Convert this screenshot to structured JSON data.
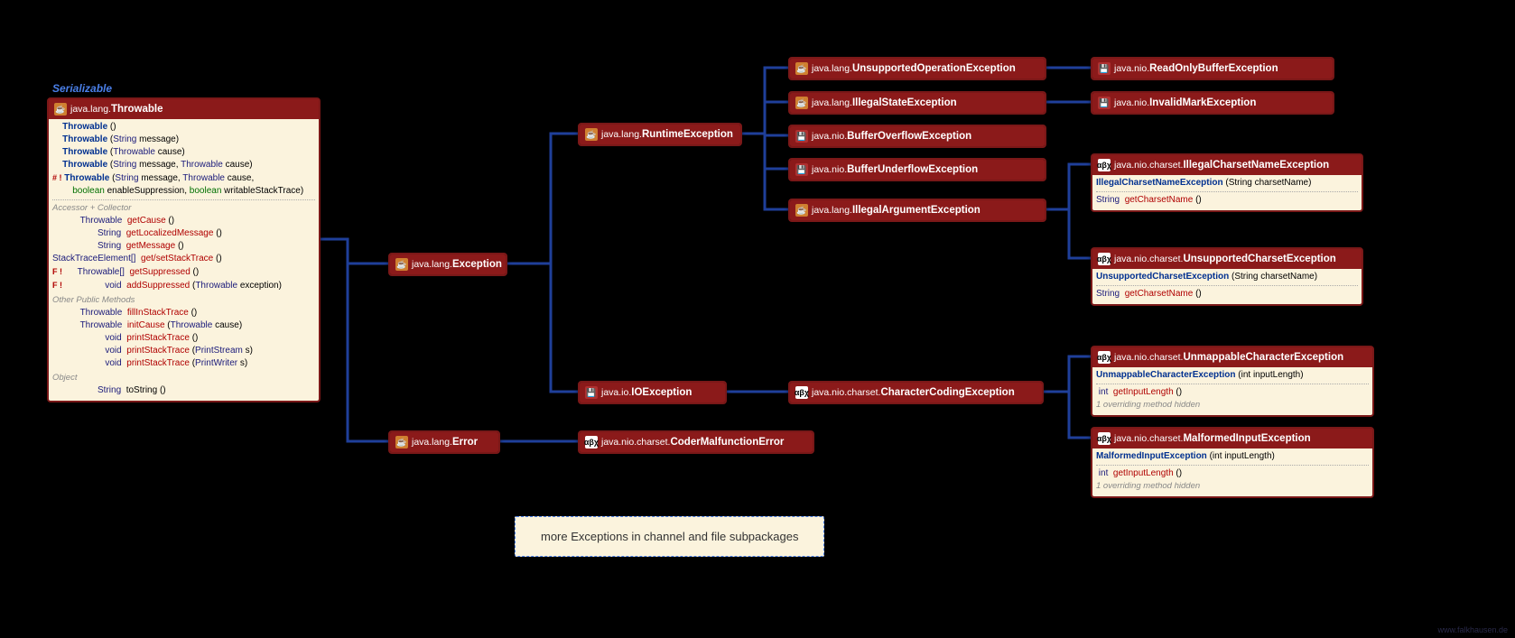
{
  "serializable_label": "Serializable",
  "throwable": {
    "pkg": "java.lang.",
    "name": "Throwable",
    "ctors": [
      {
        "name": "Throwable",
        "params": []
      },
      {
        "name": "Throwable",
        "params": [
          {
            "t": "String",
            "n": "message"
          }
        ]
      },
      {
        "name": "Throwable",
        "params": [
          {
            "t": "Throwable",
            "n": "cause"
          }
        ]
      },
      {
        "name": "Throwable",
        "params": [
          {
            "t": "String",
            "n": "message"
          },
          {
            "t": "Throwable",
            "n": "cause"
          }
        ]
      },
      {
        "name": "Throwable",
        "params": [
          {
            "t": "String",
            "n": "message"
          },
          {
            "t": "Throwable",
            "n": "cause"
          }
        ],
        "more": "boolean enableSuppression, boolean writableStackTrace",
        "marker": "# !"
      }
    ],
    "sec1": "Accessor + Collector",
    "accessors": [
      {
        "ret": "Throwable",
        "name": "getCause",
        "params": "()"
      },
      {
        "ret": "String",
        "name": "getLocalizedMessage",
        "params": "()"
      },
      {
        "ret": "String",
        "name": "getMessage",
        "params": "()"
      },
      {
        "ret": "StackTraceElement[]",
        "name": "get/setStackTrace",
        "params": "()"
      },
      {
        "ret": "Throwable[]",
        "name": "getSuppressed",
        "params": "()",
        "marker": "F !"
      },
      {
        "ret": "void",
        "name": "addSuppressed",
        "params": "(Throwable exception)",
        "marker": "F !"
      }
    ],
    "sec2": "Other Public Methods",
    "others": [
      {
        "ret": "Throwable",
        "name": "fillInStackTrace",
        "params": "()"
      },
      {
        "ret": "Throwable",
        "name": "initCause",
        "params": "(Throwable cause)"
      },
      {
        "ret": "void",
        "name": "printStackTrace",
        "params": "()"
      },
      {
        "ret": "void",
        "name": "printStackTrace",
        "params": "(PrintStream s)"
      },
      {
        "ret": "void",
        "name": "printStackTrace",
        "params": "(PrintWriter s)"
      }
    ],
    "sec3": "Object",
    "obj": [
      {
        "ret": "String",
        "name": "toString",
        "params": "()"
      }
    ]
  },
  "exception": {
    "pkg": "java.lang.",
    "name": "Exception"
  },
  "error": {
    "pkg": "java.lang.",
    "name": "Error"
  },
  "runtime": {
    "pkg": "java.lang.",
    "name": "RuntimeException"
  },
  "ioexception": {
    "pkg": "java.io.",
    "name": "IOException"
  },
  "codermalfunction": {
    "pkg": "java.nio.charset.",
    "name": "CoderMalfunctionError"
  },
  "unsupportedop": {
    "pkg": "java.lang.",
    "name": "UnsupportedOperationException"
  },
  "illegalstate": {
    "pkg": "java.lang.",
    "name": "IllegalStateException"
  },
  "bufferoverflow": {
    "pkg": "java.nio.",
    "name": "BufferOverflowException"
  },
  "bufferunderflow": {
    "pkg": "java.nio.",
    "name": "BufferUnderflowException"
  },
  "illegalarg": {
    "pkg": "java.lang.",
    "name": "IllegalArgumentException"
  },
  "readonlybuffer": {
    "pkg": "java.nio.",
    "name": "ReadOnlyBufferException"
  },
  "invalidmark": {
    "pkg": "java.nio.",
    "name": "InvalidMarkException"
  },
  "charcoding": {
    "pkg": "java.nio.charset.",
    "name": "CharacterCodingException"
  },
  "illegalcharset": {
    "pkg": "java.nio.charset.",
    "name": "IllegalCharsetNameException",
    "ctor": {
      "name": "IllegalCharsetNameException",
      "params": "(String charsetName)"
    },
    "m": {
      "ret": "String",
      "name": "getCharsetName",
      "params": "()"
    }
  },
  "unsupportedcharset": {
    "pkg": "java.nio.charset.",
    "name": "UnsupportedCharsetException",
    "ctor": {
      "name": "UnsupportedCharsetException",
      "params": "(String charsetName)"
    },
    "m": {
      "ret": "String",
      "name": "getCharsetName",
      "params": "()"
    }
  },
  "unmappable": {
    "pkg": "java.nio.charset.",
    "name": "UnmappableCharacterException",
    "ctor": {
      "name": "UnmappableCharacterException",
      "params": "(int inputLength)"
    },
    "m": {
      "ret": "int",
      "name": "getInputLength",
      "params": "()"
    },
    "override": "1 overriding method hidden"
  },
  "malformed": {
    "pkg": "java.nio.charset.",
    "name": "MalformedInputException",
    "ctor": {
      "name": "MalformedInputException",
      "params": "(int inputLength)"
    },
    "m": {
      "ret": "int",
      "name": "getInputLength",
      "params": "()"
    },
    "override": "1 overriding method hidden"
  },
  "note": "more Exceptions in channel and file subpackages",
  "watermark": "www.falkhausen.de"
}
